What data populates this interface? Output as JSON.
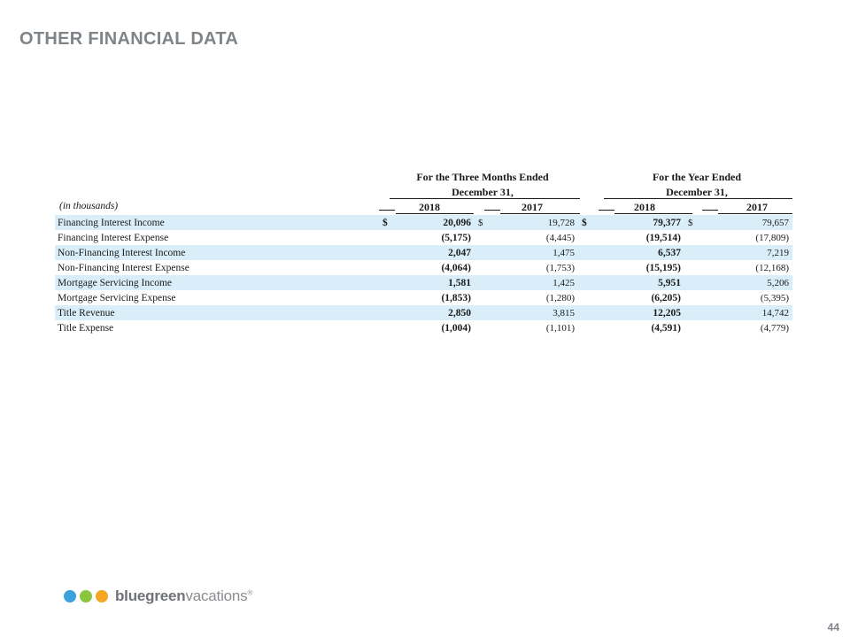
{
  "title": "OTHER FINANCIAL DATA",
  "table": {
    "group_headers": [
      {
        "line1": "For the Three Months Ended",
        "line2": "December 31,"
      },
      {
        "line1": "For the Year Ended",
        "line2": "December 31,"
      }
    ],
    "units_label": "(in thousands)",
    "columns": [
      "2018",
      "2017",
      "2018",
      "2017"
    ],
    "currency_symbol": "$",
    "rows": [
      {
        "label": "Financing Interest Income",
        "values": [
          "20,096",
          "19,728",
          "79,377",
          "79,657"
        ]
      },
      {
        "label": "Financing Interest Expense",
        "values": [
          "(5,175)",
          "(4,445)",
          "(19,514)",
          "(17,809)"
        ]
      },
      {
        "label": "Non-Financing Interest Income",
        "values": [
          "2,047",
          "1,475",
          "6,537",
          "7,219"
        ]
      },
      {
        "label": "Non-Financing Interest Expense",
        "values": [
          "(4,064)",
          "(1,753)",
          "(15,195)",
          "(12,168)"
        ]
      },
      {
        "label": "Mortgage Servicing Income",
        "values": [
          "1,581",
          "1,425",
          "5,951",
          "5,206"
        ]
      },
      {
        "label": "Mortgage Servicing Expense",
        "values": [
          "(1,853)",
          "(1,280)",
          "(6,205)",
          "(5,395)"
        ]
      },
      {
        "label": "Title Revenue",
        "values": [
          "2,850",
          "3,815",
          "12,205",
          "14,742"
        ]
      },
      {
        "label": "Title Expense",
        "values": [
          "(1,004)",
          "(1,101)",
          "(4,591)",
          "(4,779)"
        ]
      }
    ]
  },
  "logo": {
    "text_bold": "bluegreen",
    "text_light": "vacations",
    "mark": "®",
    "dot_colors": [
      "#3aa3dc",
      "#8cc63f",
      "#f5a623"
    ]
  },
  "page_number": "44",
  "colors": {
    "row_shade": "#daeef9",
    "title": "#7f8489"
  }
}
